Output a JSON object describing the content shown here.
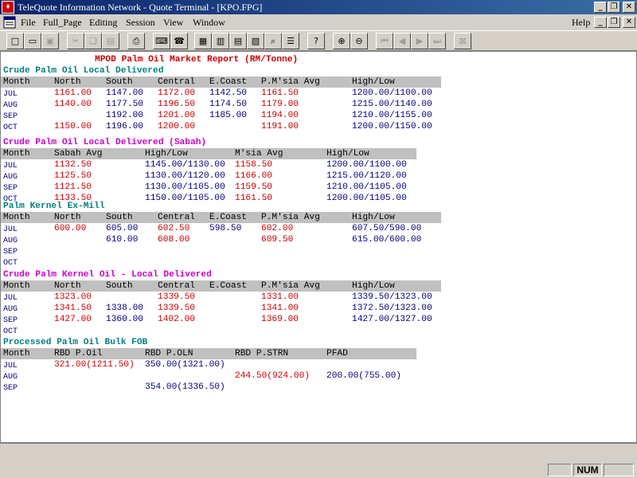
{
  "window": {
    "title": "TeleQuote Information Network - Quote Terminal - [KPO.FPG]"
  },
  "menu": {
    "items": [
      "File",
      "Full_Page",
      "Editing",
      "Session",
      "View",
      "Window"
    ],
    "help": "Help"
  },
  "report": {
    "title": "MPOD Palm Oil Market Report (RM/Tonne)",
    "sections": [
      {
        "title": "Crude Palm Oil Local Delivered",
        "headers": [
          "Month",
          "North",
          "South",
          "Central",
          "E.Coast",
          "P.M'sia Avg",
          "High/Low"
        ],
        "rows": [
          [
            "JUL",
            "1161.00",
            "1147.00",
            "1172.00",
            "1142.50",
            "1161.50",
            "1200.00/1100.00"
          ],
          [
            "AUG",
            "1140.00",
            "1177.50",
            "1196.50",
            "1174.50",
            "1179.00",
            "1215.00/1140.00"
          ],
          [
            "SEP",
            "",
            "1192.00",
            "1201.00",
            "1185.00",
            "1194.00",
            "1210.00/1155.00"
          ],
          [
            "OCT",
            "1150.00",
            "1196.00",
            "1200.00",
            "",
            "1191.00",
            "1200.00/1150.00"
          ]
        ]
      },
      {
        "title": "Crude Palm Oil Local Delivered (Sabah)",
        "headers": [
          "Month",
          "Sabah Avg",
          "High/Low",
          "M'sia Avg",
          "High/Low"
        ],
        "rows": [
          [
            "JUL",
            "1132.50",
            "1145.00/1130.00",
            "1158.50",
            "1200.00/1100.00"
          ],
          [
            "AUG",
            "1125.50",
            "1130.00/1120.00",
            "1166.00",
            "1215.00/1120.00"
          ],
          [
            "SEP",
            "1121.50",
            "1130.00/1105.00",
            "1159.50",
            "1210.00/1105.00"
          ],
          [
            "OCT",
            "1133.50",
            "1150.00/1105.00",
            "1161.50",
            "1200.00/1105.00"
          ]
        ]
      },
      {
        "title": "Palm Kernel Ex-Mill",
        "headers": [
          "Month",
          "North",
          "South",
          "Central",
          "E.Coast",
          "P.M'sia Avg",
          "High/Low"
        ],
        "rows": [
          [
            "JUL",
            "600.00",
            "605.00",
            "602.50",
            "598.50",
            "602.00",
            "607.50/590.00"
          ],
          [
            "AUG",
            "",
            "610.00",
            "608.00",
            "",
            "609.50",
            "615.00/600.00"
          ],
          [
            "SEP",
            "",
            "",
            "",
            "",
            "",
            ""
          ],
          [
            "OCT",
            "",
            "",
            "",
            "",
            "",
            ""
          ]
        ]
      },
      {
        "title": "Crude Palm Kernel Oil - Local Delivered",
        "headers": [
          "Month",
          "North",
          "South",
          "Central",
          "E.Coast",
          "P.M'sia Avg",
          "High/Low"
        ],
        "rows": [
          [
            "JUL",
            "1323.00",
            "",
            "1339.50",
            "",
            "1331.00",
            "1339.50/1323.00"
          ],
          [
            "AUG",
            "1341.50",
            "1338.00",
            "1339.50",
            "",
            "1341.00",
            "1372.50/1323.00"
          ],
          [
            "SEP",
            "1427.00",
            "1360.00",
            "1402.00",
            "",
            "1369.00",
            "1427.00/1327.00"
          ],
          [
            "OCT",
            "",
            "",
            "",
            "",
            "",
            ""
          ]
        ]
      },
      {
        "title": "Processed Palm Oil Bulk FOB",
        "headers": [
          "Month",
          "RBD P.Oil",
          "RBD P.OLN",
          "RBD P.STRN",
          "PFAD"
        ],
        "rows": [
          [
            "JUL",
            "321.00(1211.50)",
            "350.00(1321.00)",
            "",
            ""
          ],
          [
            "AUG",
            "",
            "",
            "244.50(924.00)",
            "200.00(755.00)"
          ],
          [
            "SEP",
            "",
            "354.00(1336.50)",
            "",
            ""
          ]
        ]
      }
    ]
  },
  "status": {
    "num": "NUM"
  }
}
